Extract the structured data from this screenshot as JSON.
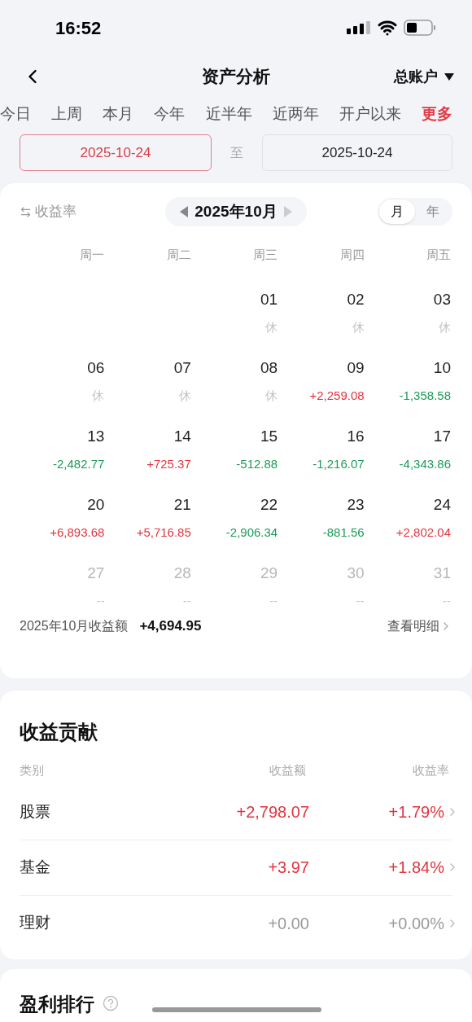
{
  "status_bar": {
    "time": "16:52"
  },
  "nav": {
    "title": "资产分析",
    "account": "总账户"
  },
  "period_tabs": [
    {
      "label": "今日",
      "kind": "period"
    },
    {
      "label": "上周",
      "kind": "period"
    },
    {
      "label": "本月",
      "kind": "period"
    },
    {
      "label": "今年",
      "kind": "period"
    },
    {
      "label": "近半年",
      "kind": "period"
    },
    {
      "label": "近两年",
      "kind": "period"
    },
    {
      "label": "开户以来",
      "kind": "period"
    },
    {
      "label": "更多",
      "kind": "more"
    }
  ],
  "date_range": {
    "start": {
      "value": "2025-10-24",
      "selected": true
    },
    "separator": "至",
    "end": {
      "value": "2025-10-24",
      "selected": false
    }
  },
  "calendar": {
    "toggle_label": "收益率",
    "month": "2025年10月",
    "view_modes": [
      {
        "label": "月",
        "selected": true
      },
      {
        "label": "年",
        "selected": false
      }
    ],
    "weekdays": [
      "周一",
      "周二",
      "周三",
      "周四",
      "周五"
    ],
    "weeks": [
      [
        {
          "day": "01",
          "note": "休",
          "kind": "muted"
        },
        {
          "day": "02",
          "note": "休",
          "kind": "muted"
        },
        {
          "day": "03",
          "note": "休",
          "kind": "muted"
        }
      ],
      [
        {
          "day": "06",
          "note": "休",
          "kind": "muted"
        },
        {
          "day": "07",
          "note": "休",
          "kind": "muted"
        },
        {
          "day": "08",
          "note": "休",
          "kind": "muted"
        },
        {
          "day": "09",
          "note": "+2,259.08",
          "kind": "up"
        },
        {
          "day": "10",
          "note": "-1,358.58",
          "kind": "down"
        }
      ],
      [
        {
          "day": "13",
          "note": "-2,482.77",
          "kind": "down"
        },
        {
          "day": "14",
          "note": "+725.37",
          "kind": "up"
        },
        {
          "day": "15",
          "note": "-512.88",
          "kind": "down"
        },
        {
          "day": "16",
          "note": "-1,216.07",
          "kind": "down"
        },
        {
          "day": "17",
          "note": "-4,343.86",
          "kind": "down"
        }
      ],
      [
        {
          "day": "20",
          "note": "+6,893.68",
          "kind": "up"
        },
        {
          "day": "21",
          "note": "+5,716.85",
          "kind": "up"
        },
        {
          "day": "22",
          "note": "-2,906.34",
          "kind": "down"
        },
        {
          "day": "23",
          "note": "-881.56",
          "kind": "down"
        },
        {
          "day": "24",
          "note": "+2,802.04",
          "kind": "up"
        }
      ],
      [
        {
          "day": "27",
          "note": "--",
          "kind": "future"
        },
        {
          "day": "28",
          "note": "--",
          "kind": "future"
        },
        {
          "day": "29",
          "note": "--",
          "kind": "future"
        },
        {
          "day": "30",
          "note": "--",
          "kind": "future"
        },
        {
          "day": "31",
          "note": "--",
          "kind": "future"
        }
      ]
    ],
    "summary_label": "2025年10月收益额",
    "summary_value": "+4,694.95",
    "detail_link": "查看明细"
  },
  "contribution": {
    "title": "收益贡献",
    "columns": [
      "类别",
      "收益额",
      "收益率"
    ],
    "rows": [
      {
        "category": "股票",
        "amount": "+2,798.07",
        "rate": "+1.79%",
        "kind": "up"
      },
      {
        "category": "基金",
        "amount": "+3.97",
        "rate": "+1.84%",
        "kind": "up"
      },
      {
        "category": "理财",
        "amount": "+0.00",
        "rate": "+0.00%",
        "kind": "flat"
      }
    ]
  },
  "ranking": {
    "title": "盈利排行"
  }
}
